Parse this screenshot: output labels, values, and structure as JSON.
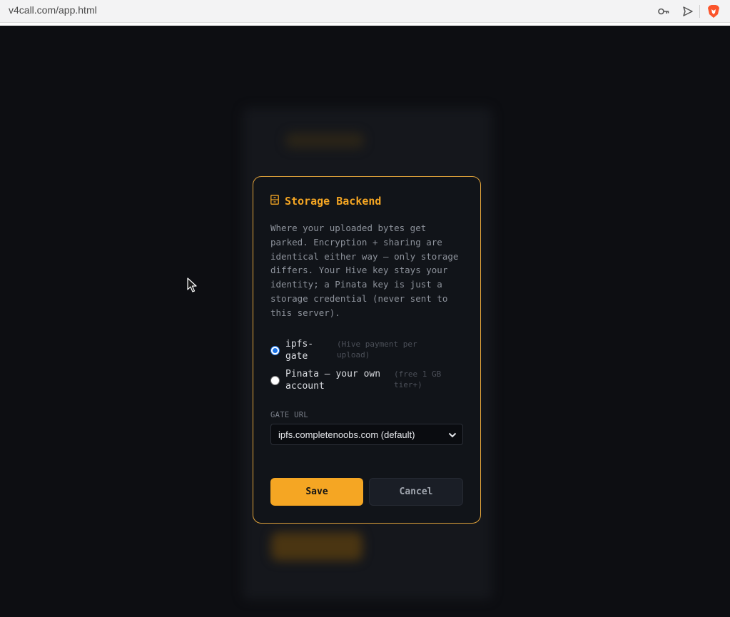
{
  "browser": {
    "url": "v4call.com/app.html",
    "icons": [
      "key-icon",
      "send-icon",
      "brave-lion-icon"
    ]
  },
  "modal": {
    "icon": "file-cabinet-icon",
    "title": "Storage Backend",
    "description": "Where your uploaded bytes get parked. Encryption + sharing are identical either way — only storage differs. Your Hive key stays your identity; a Pinata key is just a storage credential (never sent to this server).",
    "options": [
      {
        "label": "ipfs-\ngate",
        "hint": "(Hive payment per upload)",
        "selected": true
      },
      {
        "label": "Pinata — your own\naccount",
        "hint": "(free 1 GB tier+)",
        "selected": false
      }
    ],
    "gate_url_label": "GATE URL",
    "gate_url_value": "ipfs.completenoobs.com (default)",
    "save_label": "Save",
    "cancel_label": "Cancel"
  },
  "colors": {
    "accent": "#f5a623",
    "background": "#0d0e12",
    "modal_bg": "#111419"
  }
}
